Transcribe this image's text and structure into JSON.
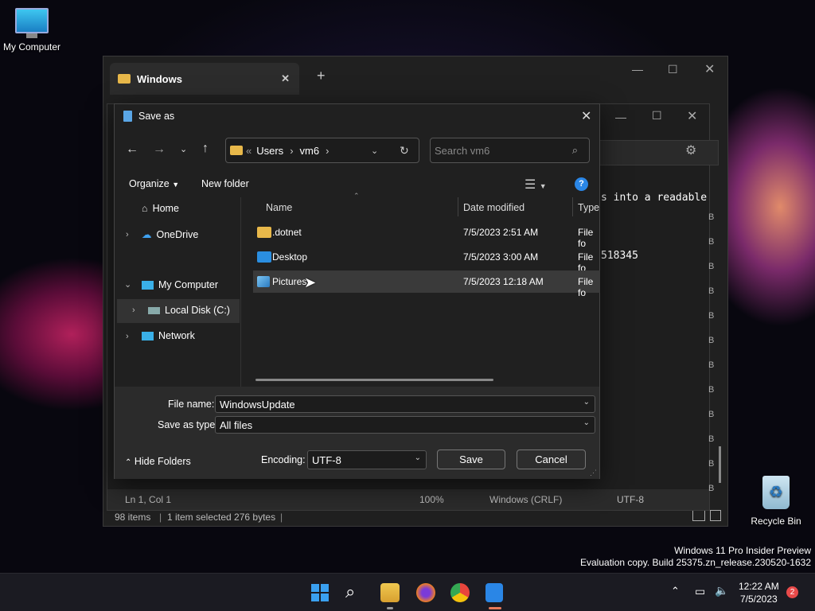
{
  "desktop": {
    "my_computer": "My Computer",
    "recycle_bin": "Recycle Bin",
    "watermark_line1": "Windows 11 Pro Insider Preview",
    "watermark_line2": "Evaluation copy. Build 25375.zn_release.230520-1632"
  },
  "explorer": {
    "tab_title": "Windows",
    "new_tab": "+",
    "status_items": "98 items",
    "status_selected": "1 item selected  276 bytes"
  },
  "notepad": {
    "text_line1": "s into a readable",
    "text_line2": "518345",
    "status_pos": "Ln 1, Col 1",
    "status_zoom": "100%",
    "status_eol": "Windows (CRLF)",
    "status_enc": "UTF-8"
  },
  "dialog": {
    "title": "Save as",
    "breadcrumb": [
      "Users",
      "vm6"
    ],
    "search_placeholder": "Search vm6",
    "organize": "Organize",
    "new_folder": "New folder",
    "nav": {
      "home": "Home",
      "onedrive": "OneDrive",
      "my_computer": "My Computer",
      "local_disk": "Local Disk (C:)",
      "network": "Network"
    },
    "columns": {
      "name": "Name",
      "date": "Date modified",
      "type": "Type"
    },
    "files": [
      {
        "name": ".dotnet",
        "date": "7/5/2023 2:51 AM",
        "type": "File fo"
      },
      {
        "name": "Desktop",
        "date": "7/5/2023 3:00 AM",
        "type": "File fo"
      },
      {
        "name": "Pictures",
        "date": "7/5/2023 12:18 AM",
        "type": "File fo"
      }
    ],
    "file_name_label": "File name:",
    "file_name_value": "WindowsUpdate",
    "save_type_label": "Save as type:",
    "save_type_value": "All files",
    "hide_folders": "Hide Folders",
    "encoding_label": "Encoding:",
    "encoding_value": "UTF-8",
    "save": "Save",
    "cancel": "Cancel"
  },
  "taskbar": {
    "time": "12:22 AM",
    "date": "7/5/2023",
    "badge": "2"
  }
}
